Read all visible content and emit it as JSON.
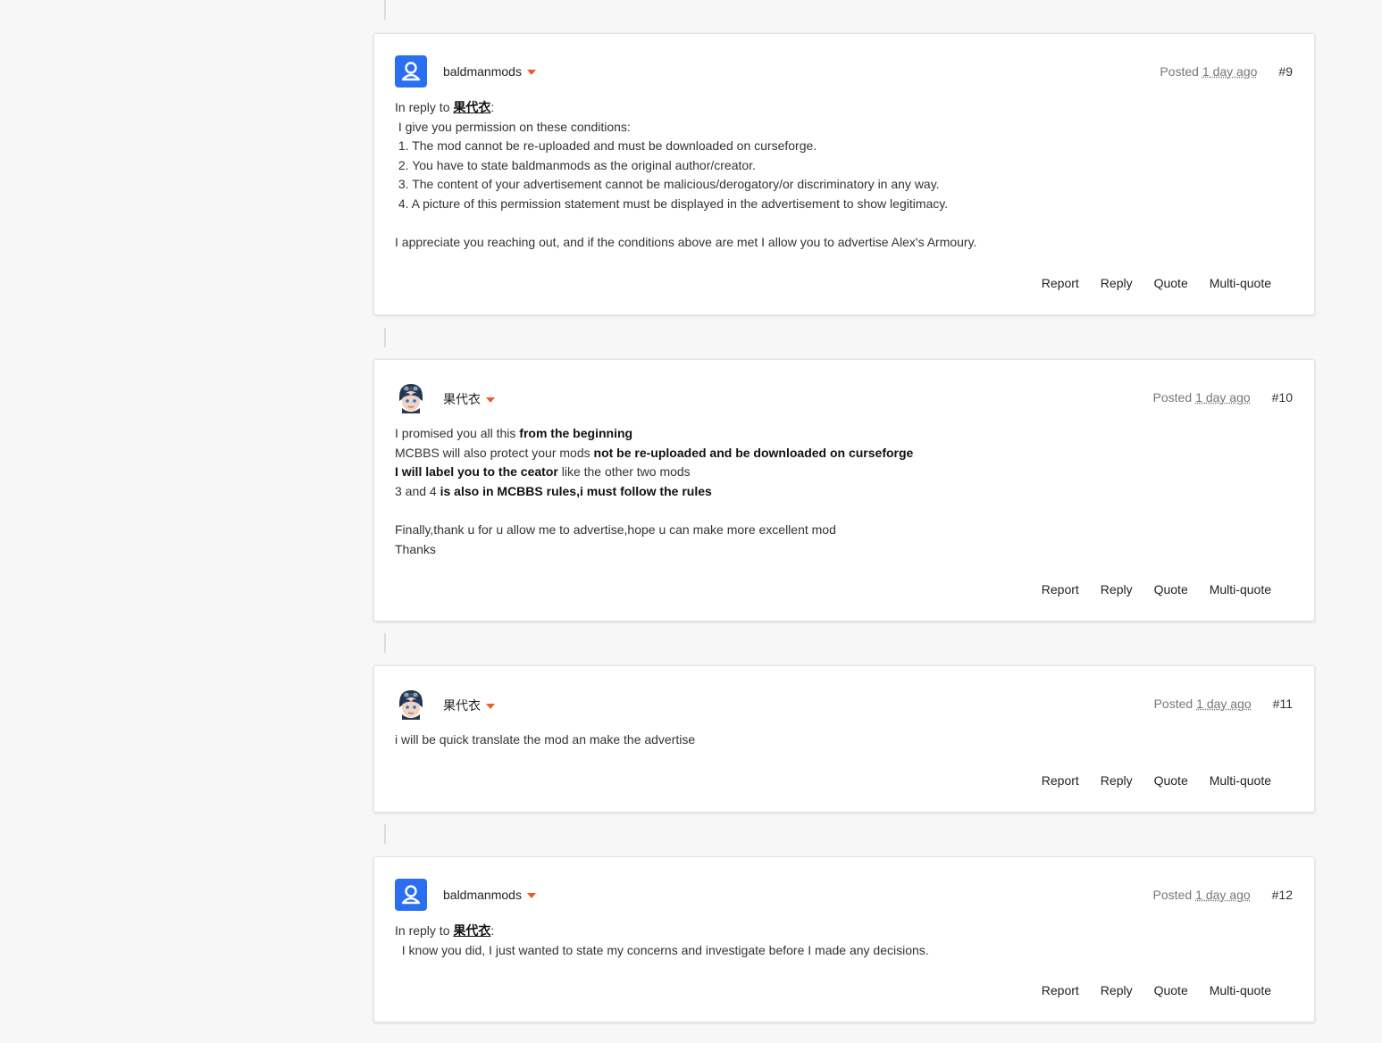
{
  "posts": [
    {
      "author": "baldmanmods",
      "avatar": "default-user-icon",
      "posted_label": "Posted",
      "posted_ago": "1 day ago",
      "number": "#9",
      "reply_prefix": "In reply to",
      "reply_to": "果代衣",
      "lines": [
        " I give you permission on these conditions:",
        " 1. The mod cannot be re-uploaded and must be downloaded on curseforge.",
        " 2. You have to state baldmanmods as the original author/creator.",
        " 3. The content of your advertisement cannot be malicious/derogatory/or discriminatory in any way.",
        " 4. A picture of this permission statement must be displayed in the advertisement to show legitimacy.",
        "",
        "I appreciate you reaching out, and if the conditions above are met I allow you to advertise Alex's Armoury."
      ]
    },
    {
      "author": "果代衣",
      "avatar": "anime-avatar",
      "posted_label": "Posted",
      "posted_ago": "1 day ago",
      "number": "#10",
      "rich_lines": [
        [
          {
            "t": "I promised you all this ",
            "b": false
          },
          {
            "t": "from the beginning",
            "b": true
          }
        ],
        [
          {
            "t": "MCBBS will also protect your mods ",
            "b": false
          },
          {
            "t": "not be re-uploaded and be downloaded on curseforge",
            "b": true
          }
        ],
        [
          {
            "t": "I will label you to the ceator",
            "b": true
          },
          {
            "t": " like the other two mods",
            "b": false
          }
        ],
        [
          {
            "t": "3 and 4 ",
            "b": false
          },
          {
            "t": "is also in MCBBS rules,i must follow the rules",
            "b": true
          }
        ],
        [],
        [
          {
            "t": "Finally,thank u for u allow me to advertise,hope u can make more excellent mod",
            "b": false
          }
        ],
        [
          {
            "t": "Thanks",
            "b": false
          }
        ]
      ]
    },
    {
      "author": "果代衣",
      "avatar": "anime-avatar",
      "posted_label": "Posted",
      "posted_ago": "1 day ago",
      "number": "#11",
      "lines": [
        "i will be quick translate the mod an make the advertise"
      ]
    },
    {
      "author": "baldmanmods",
      "avatar": "default-user-icon",
      "posted_label": "Posted",
      "posted_ago": "1 day ago",
      "number": "#12",
      "reply_prefix": "In reply to",
      "reply_to": "果代衣",
      "lines": [
        "  I know you did, I just wanted to state my concerns and investigate before I made any decisions."
      ]
    }
  ],
  "actions": {
    "report": "Report",
    "reply": "Reply",
    "quote": "Quote",
    "multiquote": "Multi-quote"
  }
}
